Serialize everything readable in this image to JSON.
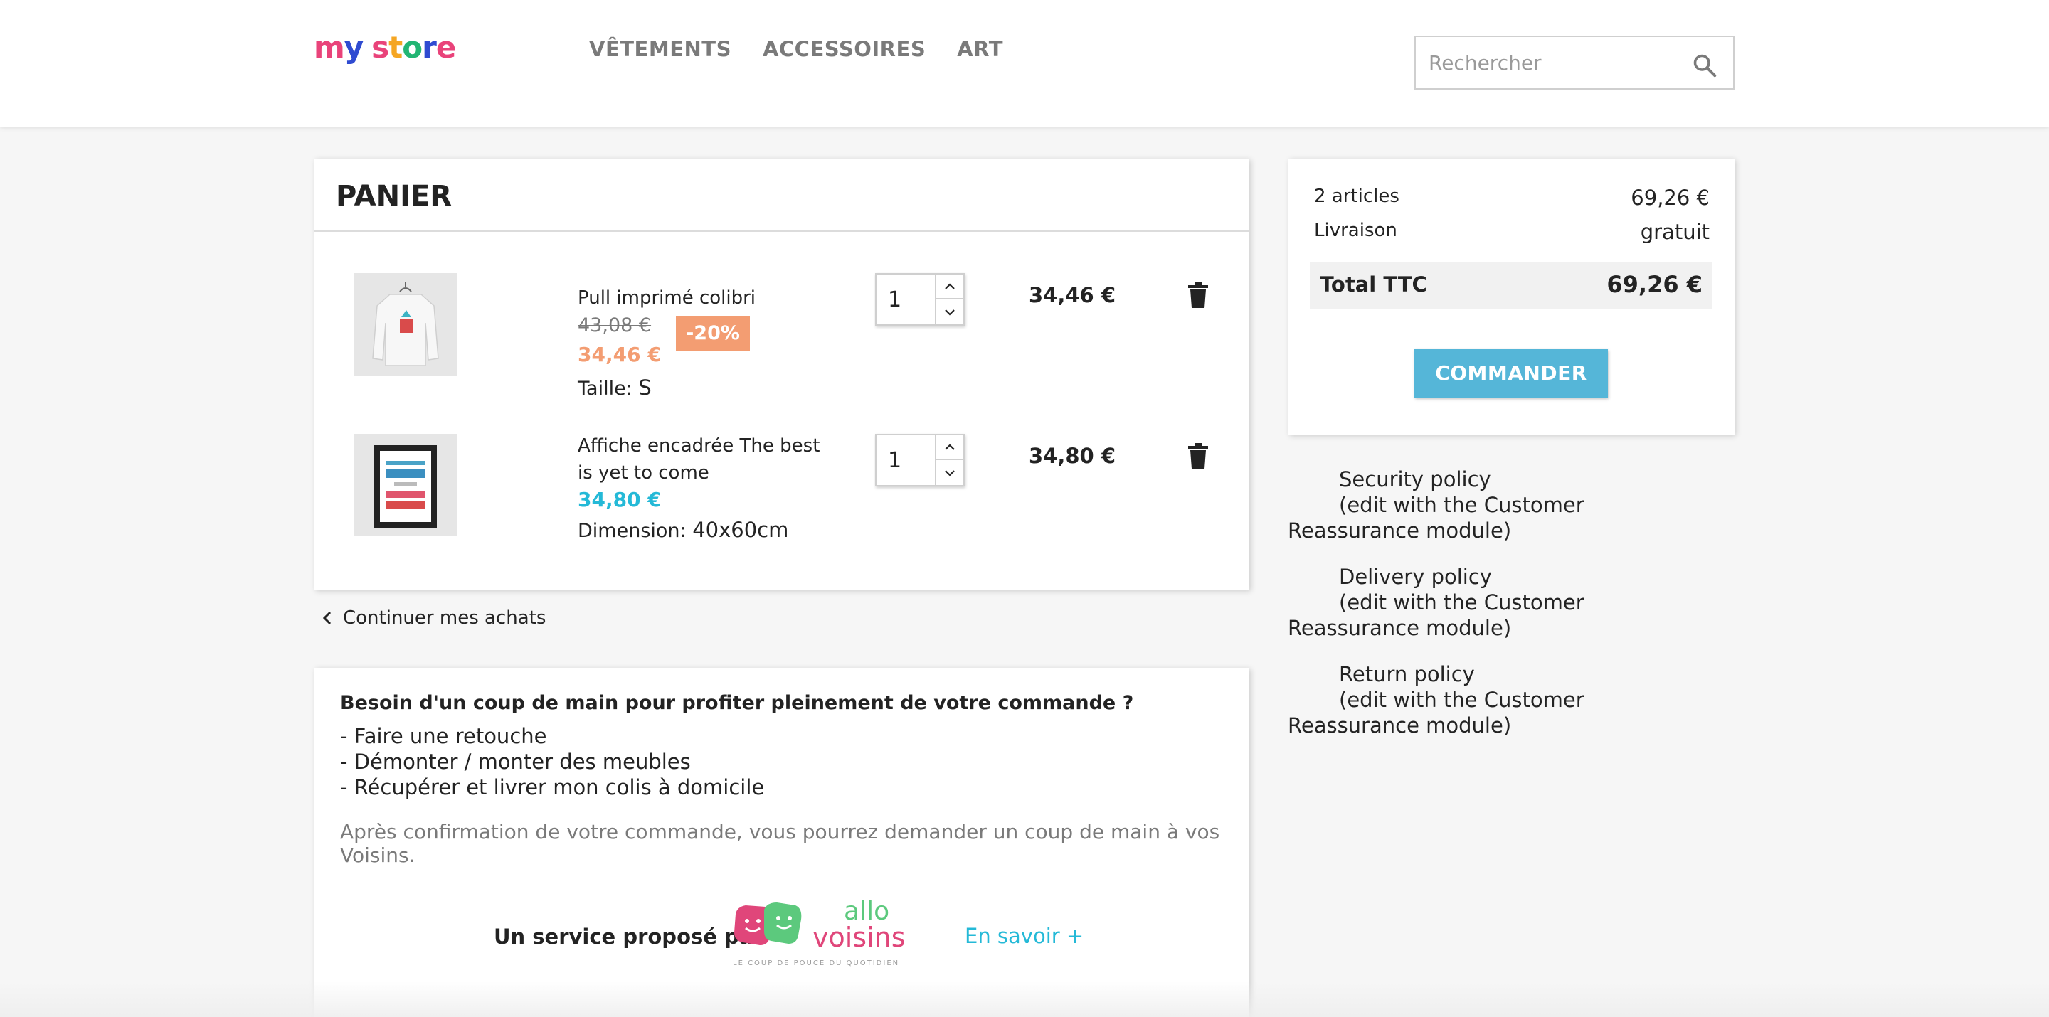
{
  "header": {
    "logo": "my store",
    "nav": [
      "VÊTEMENTS",
      "ACCESSOIRES",
      "ART"
    ],
    "search_placeholder": "Rechercher"
  },
  "cart": {
    "title": "PANIER",
    "items": [
      {
        "name": "Pull imprimé colibri",
        "old_price": "43,08 €",
        "discount": "-20%",
        "price": "34,46 €",
        "attr_label": "Taille:",
        "attr_value": "S",
        "qty": "1",
        "total": "34,46 €"
      },
      {
        "name": "Affiche encadrée The best is yet to come",
        "price": "34,80 €",
        "attr_label": "Dimension:",
        "attr_value": "40x60cm",
        "qty": "1",
        "total": "34,80 €"
      }
    ],
    "continue_label": "Continuer mes achats"
  },
  "service": {
    "title": "Besoin d'un coup de main pour profiter pleinement de votre commande ?",
    "items": [
      "- Faire une retouche",
      "- Démonter / monter des meubles",
      "- Récupérer et livrer mon colis à domicile"
    ],
    "note": "Après confirmation de votre commande, vous pourrez demander un coup de main à vos Voisins.",
    "by_label": "Un service proposé par",
    "logo_word1": "allo",
    "logo_word2": "voisins",
    "logo_tagline": "LE COUP DE POUCE DU QUOTIDIEN",
    "link": "En savoir +"
  },
  "summary": {
    "articles_label": "2 articles",
    "articles_value": "69,26 €",
    "shipping_label": "Livraison",
    "shipping_value": "gratuit",
    "total_label": "Total TTC",
    "total_value": "69,26 €",
    "checkout": "COMMANDER"
  },
  "reassurance": [
    {
      "title": "Security policy",
      "desc": "(edit with the Customer Reassurance module)"
    },
    {
      "title": "Delivery policy",
      "desc": "(edit with the Customer Reassurance module)"
    },
    {
      "title": "Return policy",
      "desc": "(edit with the Customer Reassurance module)"
    }
  ],
  "colors": {
    "accent": "#24b9d7",
    "discount": "#f39d72",
    "checkout": "#55b6d8"
  }
}
